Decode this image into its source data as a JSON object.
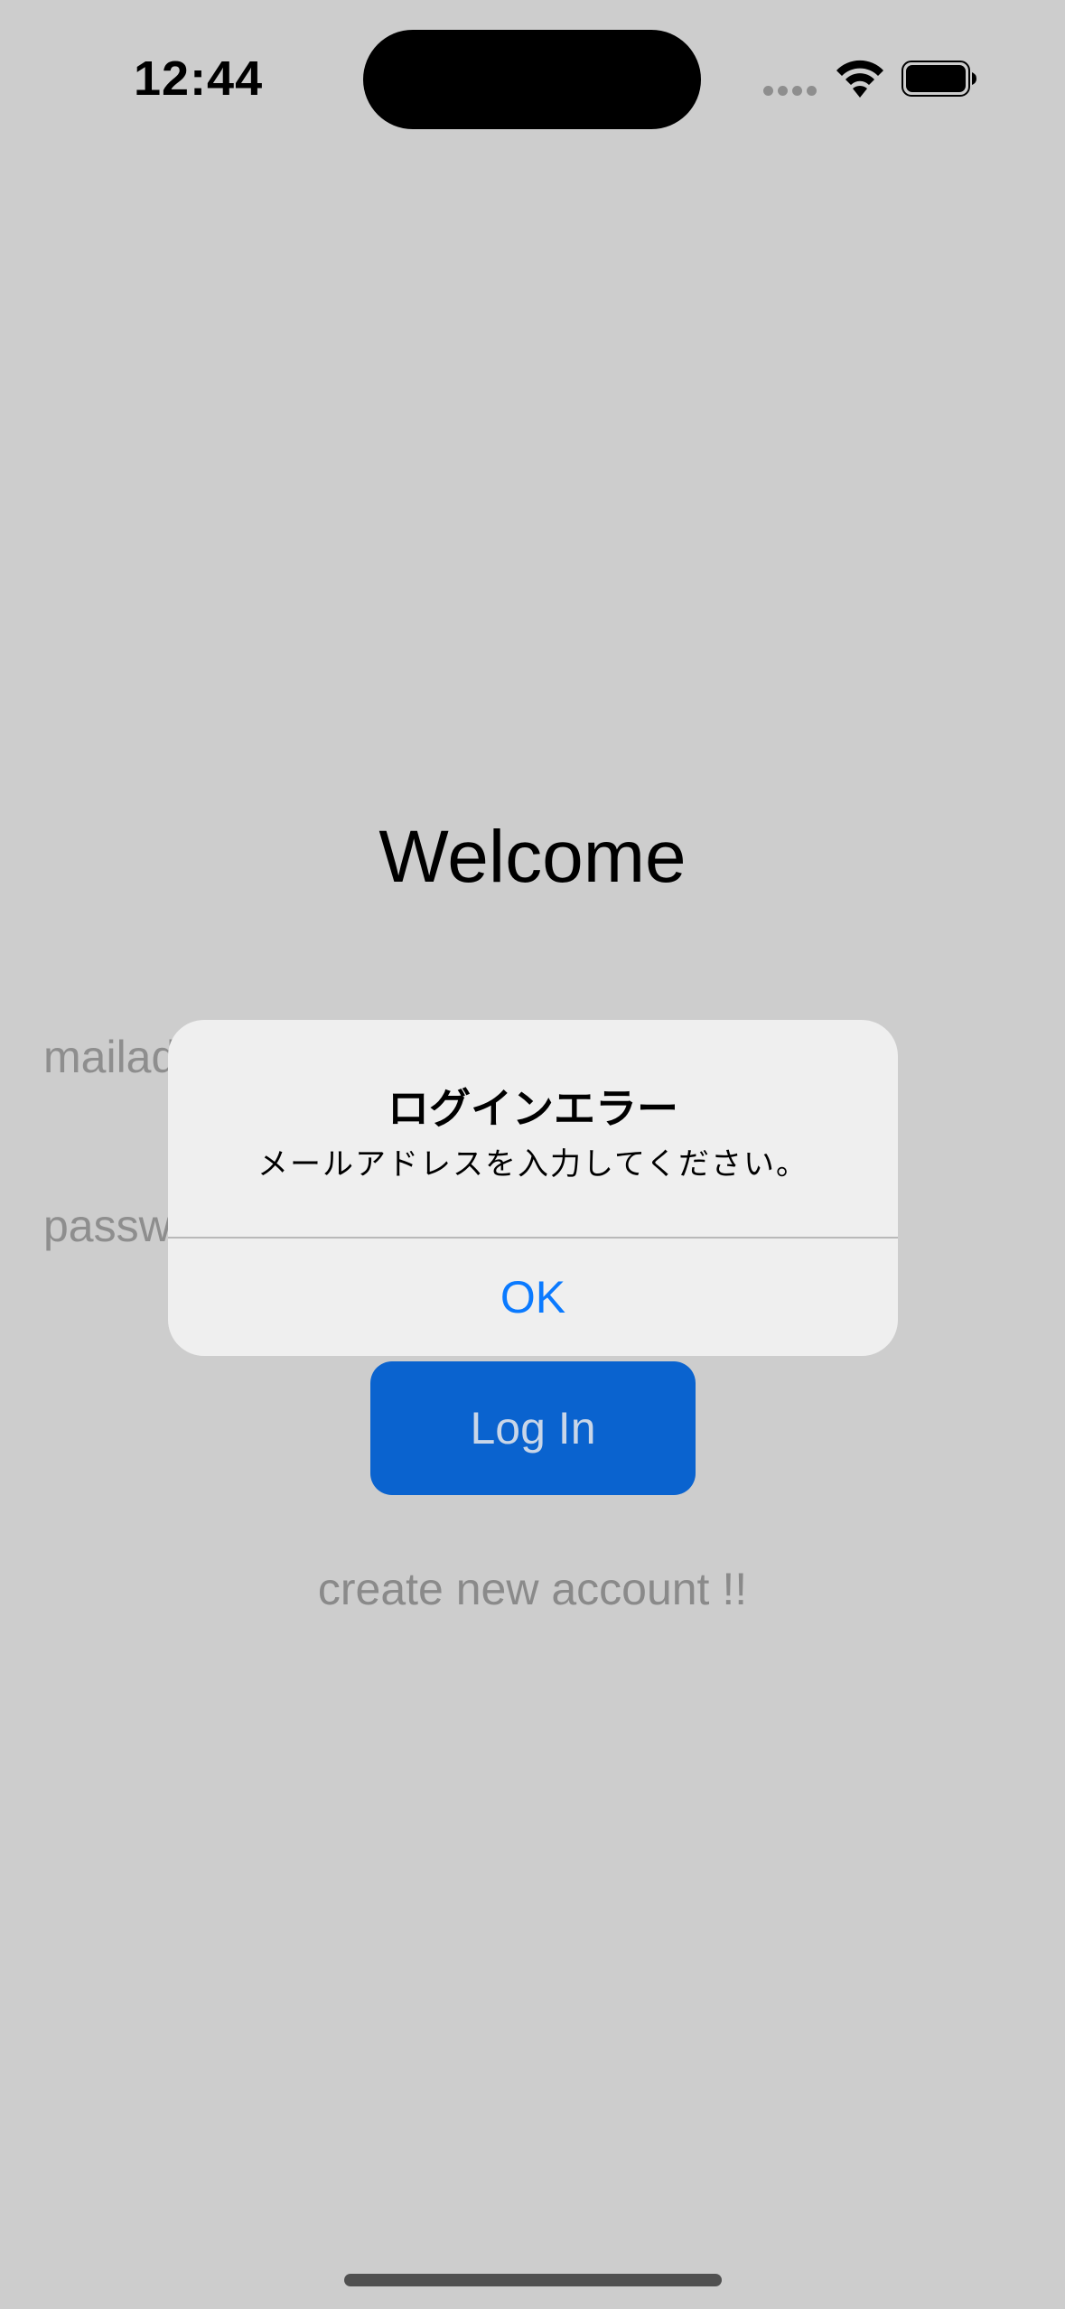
{
  "status_bar": {
    "time": "12:44"
  },
  "login": {
    "title": "Welcome",
    "mail_placeholder": "mailaddress",
    "password_placeholder": "password",
    "login_button": "Log In",
    "create_account": "create new account !!"
  },
  "alert": {
    "title": "ログインエラー",
    "message": "メールアドレスを入力してください。",
    "ok_button": "OK"
  },
  "colors": {
    "accent_blue": "#0a7aff",
    "login_button_bg": "#0a63cf",
    "dimmed_background": "#cdcdcd",
    "alert_background": "#efefef"
  },
  "icons": [
    "cellular-signal-icon",
    "wifi-icon",
    "battery-icon"
  ]
}
